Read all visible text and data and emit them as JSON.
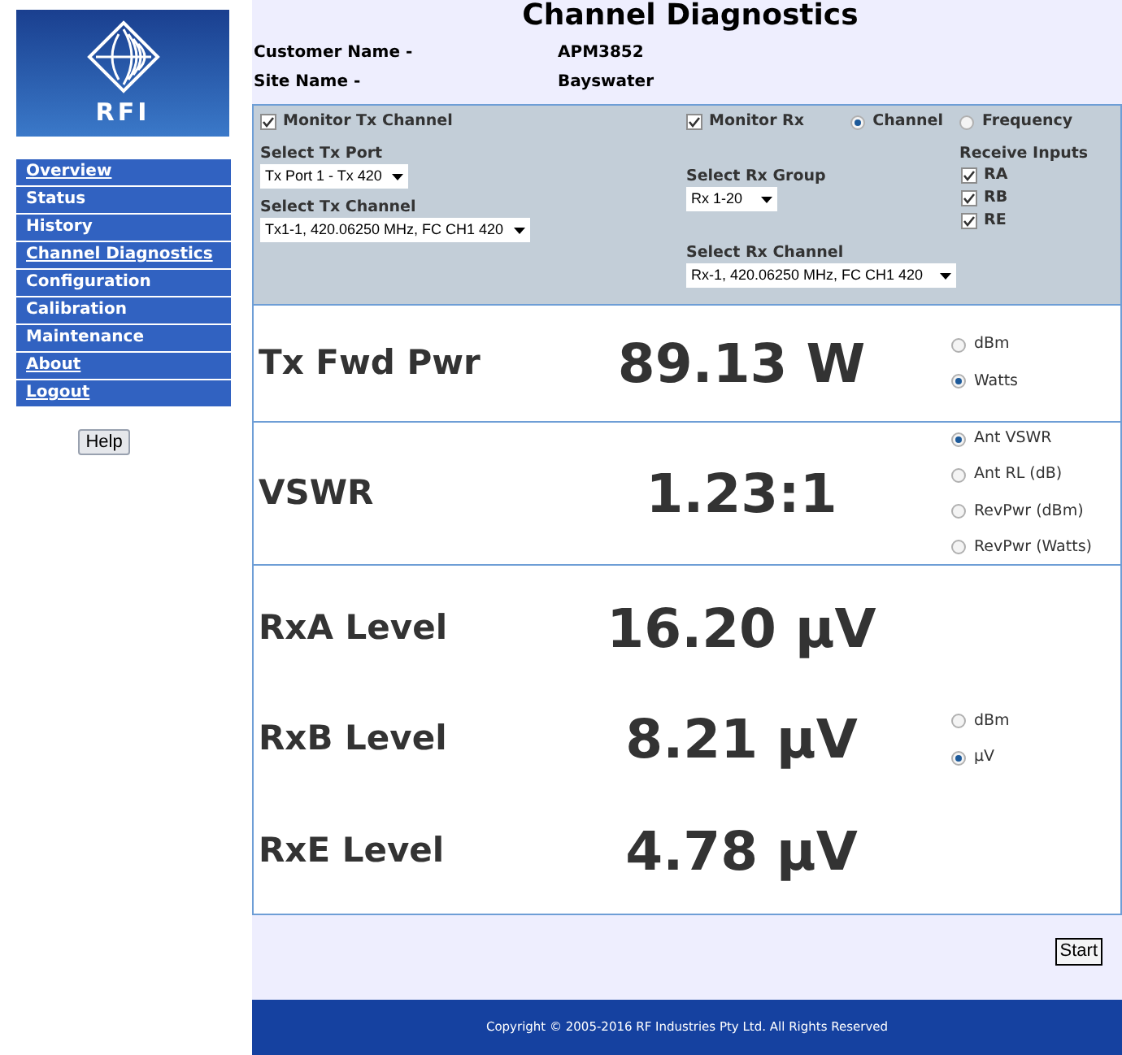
{
  "logo": {
    "text": "RFI"
  },
  "nav": [
    {
      "label": "Overview",
      "underlined": true
    },
    {
      "label": "Status",
      "underlined": false
    },
    {
      "label": "History",
      "underlined": false
    },
    {
      "label": "Channel Diagnostics",
      "underlined": true
    },
    {
      "label": "Configuration",
      "underlined": false
    },
    {
      "label": "Calibration",
      "underlined": false
    },
    {
      "label": "Maintenance",
      "underlined": false
    },
    {
      "label": "About",
      "underlined": true
    },
    {
      "label": "Logout",
      "underlined": true
    }
  ],
  "help_button": "Help",
  "title": "Channel Diagnostics",
  "info": [
    {
      "label": "Customer Name -",
      "value": "APM3852"
    },
    {
      "label": "Site Name -",
      "value": "Bayswater"
    }
  ],
  "controls": {
    "monitor_tx": {
      "label": "Monitor Tx Channel",
      "checked": true
    },
    "tx_port": {
      "label": "Select Tx Port",
      "value": "Tx Port 1 - Tx 420"
    },
    "tx_channel": {
      "label": "Select Tx Channel",
      "value": "Tx1-1, 420.06250 MHz, FC CH1 420"
    },
    "monitor_rx": {
      "label": "Monitor Rx",
      "checked": true
    },
    "rx_mode": [
      {
        "label": "Channel",
        "selected": true
      },
      {
        "label": "Frequency",
        "selected": false
      }
    ],
    "rx_group": {
      "label": "Select Rx Group",
      "value": "Rx 1-20"
    },
    "rx_channel": {
      "label": "Select Rx Channel",
      "value": "Rx-1, 420.06250 MHz, FC CH1 420"
    },
    "receive_inputs": {
      "title": "Receive Inputs",
      "items": [
        {
          "label": "RA",
          "checked": true
        },
        {
          "label": "RB",
          "checked": true
        },
        {
          "label": "RE",
          "checked": true
        }
      ]
    }
  },
  "measurements": [
    {
      "readings": [
        {
          "label": "Tx Fwd Pwr",
          "value": "89.13 W"
        }
      ],
      "options": [
        {
          "label": "dBm",
          "selected": false
        },
        {
          "label": "Watts",
          "selected": true
        }
      ]
    },
    {
      "readings": [
        {
          "label": "VSWR",
          "value": "1.23:1"
        }
      ],
      "options": [
        {
          "label": "Ant VSWR",
          "selected": true
        },
        {
          "label": "Ant RL (dB)",
          "selected": false
        },
        {
          "label": "RevPwr (dBm)",
          "selected": false
        },
        {
          "label": "RevPwr (Watts)",
          "selected": false
        }
      ]
    },
    {
      "readings": [
        {
          "label": "RxA Level",
          "value": "16.20 µV"
        },
        {
          "label": "RxB Level",
          "value": "8.21 µV"
        },
        {
          "label": "RxE Level",
          "value": "4.78 µV"
        }
      ],
      "options": [
        {
          "label": "dBm",
          "selected": false
        },
        {
          "label": "µV",
          "selected": true
        }
      ]
    }
  ],
  "start_button": "Start",
  "footer": "Copyright © 2005-2016 RF Industries Pty Ltd. All Rights Reserved"
}
